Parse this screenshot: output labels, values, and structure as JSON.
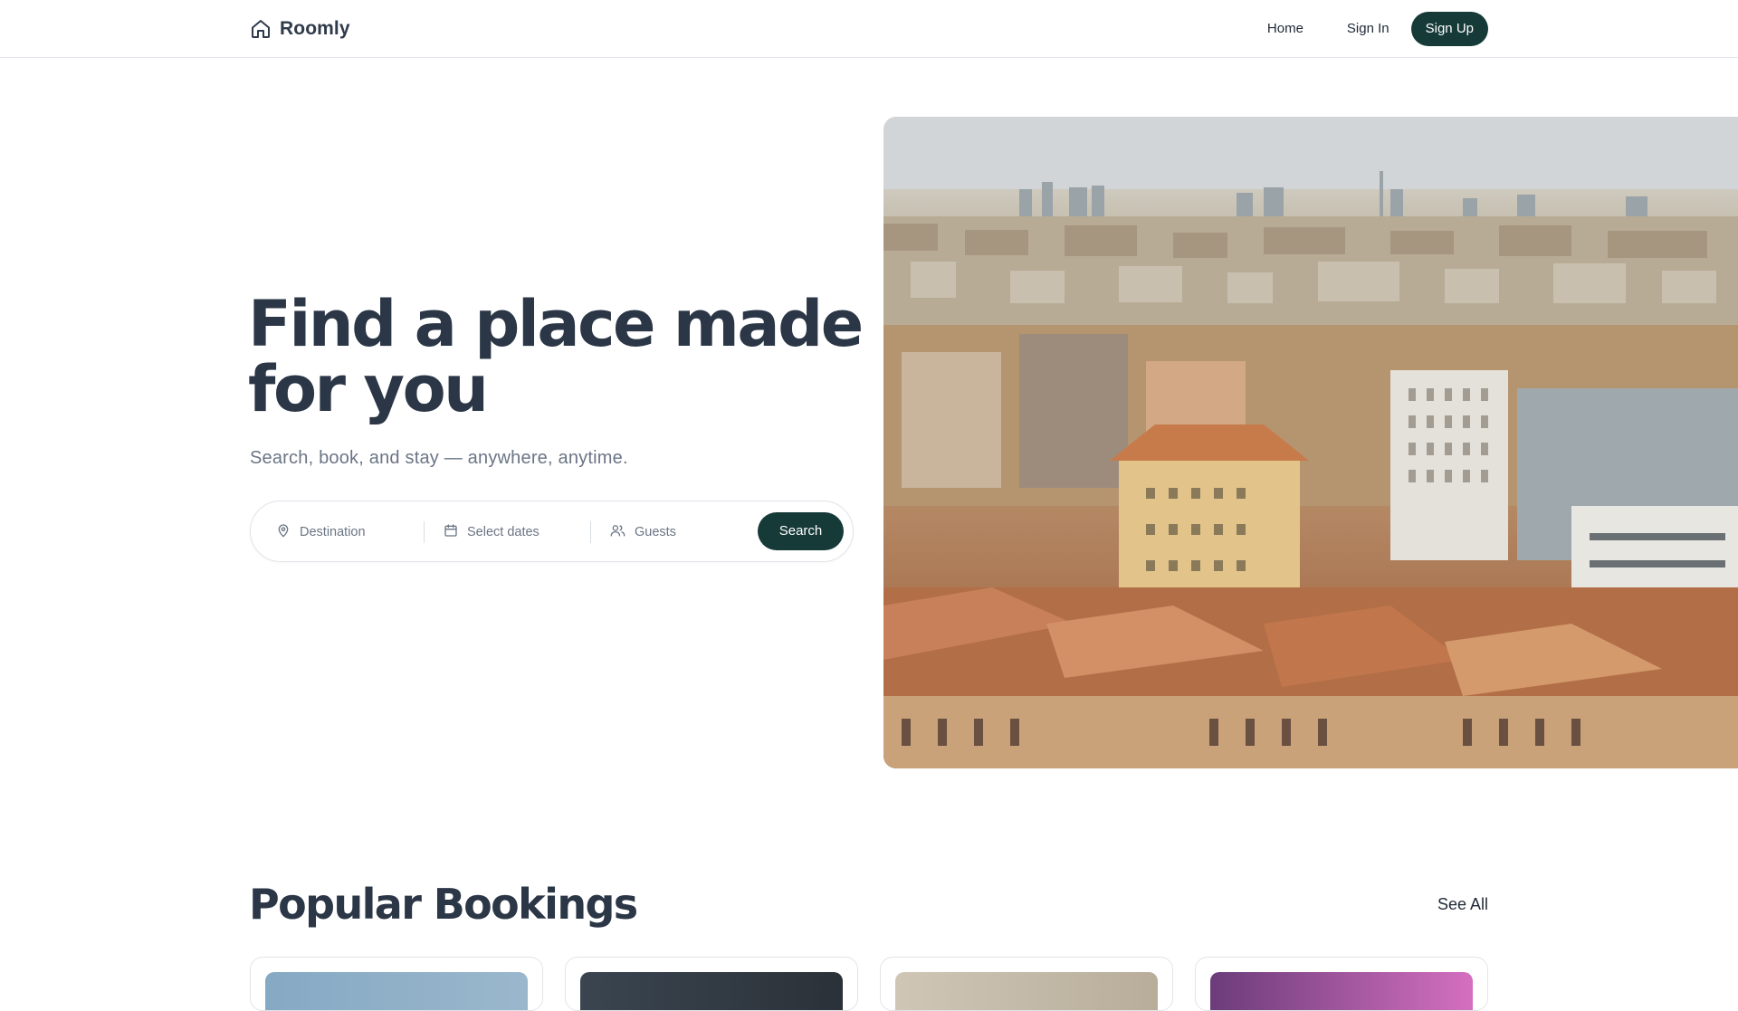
{
  "header": {
    "brand": "Roomly",
    "logo_icon": "home-icon",
    "nav": {
      "home": "Home",
      "sign_in": "Sign In",
      "sign_up": "Sign Up"
    }
  },
  "hero": {
    "title": "Find a place made for you",
    "subtitle": "Search, book, and stay — anywhere, anytime.",
    "search": {
      "destination_placeholder": "Destination",
      "dates_placeholder": "Select dates",
      "guests_placeholder": "Guests",
      "button_label": "Search",
      "icons": [
        "map-pin-icon",
        "calendar-icon",
        "users-icon"
      ]
    },
    "image": "city-skyline-photo"
  },
  "popular": {
    "title": "Popular Bookings",
    "see_all": "See All",
    "cards": [
      {
        "image": "booking-photo-1"
      },
      {
        "image": "booking-photo-2"
      },
      {
        "image": "booking-photo-3"
      },
      {
        "image": "booking-photo-4"
      }
    ]
  },
  "colors": {
    "accent": "#163a38",
    "heading": "#2b3646",
    "muted": "#6b7585",
    "border": "#e3e6ea"
  }
}
